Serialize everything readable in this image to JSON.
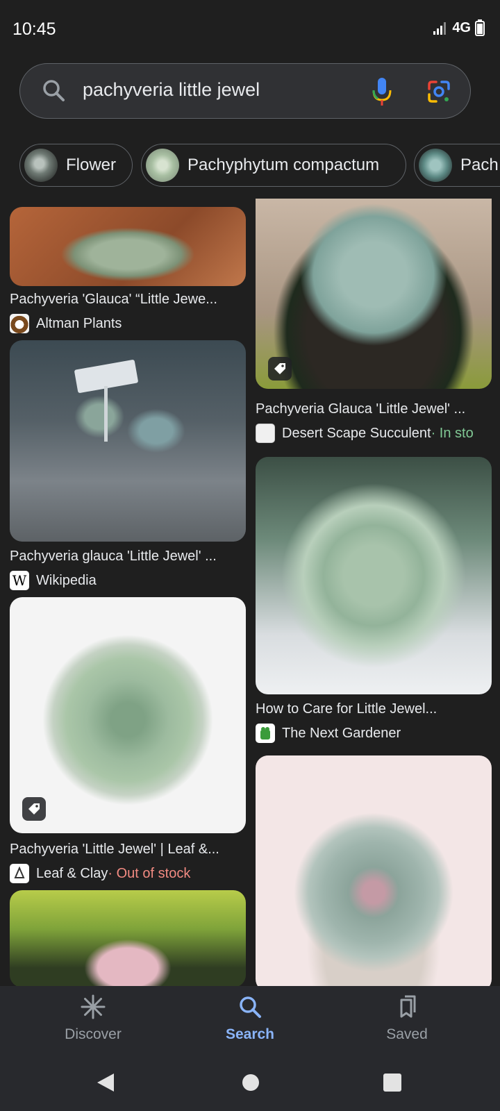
{
  "status": {
    "time": "10:45",
    "network": "4G"
  },
  "search": {
    "query": "pachyveria little jewel"
  },
  "chips": [
    {
      "label": "Flower"
    },
    {
      "label": "Pachyphytum compactum"
    },
    {
      "label": "Pach"
    }
  ],
  "results_left": [
    {
      "title": "Pachyveria 'Glauca' “Little Jewe...",
      "source": "Altman Plants",
      "stock": ""
    },
    {
      "title": "Pachyveria glauca 'Little Jewel' ...",
      "source": "Wikipedia",
      "stock": ""
    },
    {
      "title": "Pachyveria 'Little Jewel' | Leaf &...",
      "source": "Leaf & Clay",
      "stock": " · Out of stock"
    }
  ],
  "results_right": [
    {
      "title": "Pachyveria Glauca 'Little Jewel' ...",
      "source": "Desert Scape Succulent",
      "stock": " · In sto"
    },
    {
      "title": "How to Care for Little Jewel...",
      "source": "The Next Gardener",
      "stock": ""
    }
  ],
  "bottom_nav": {
    "discover": "Discover",
    "search": "Search",
    "saved": "Saved"
  },
  "colors": {
    "background": "#1f1f1f",
    "active": "#8ab4f8",
    "in_stock": "#81c995",
    "out_of_stock": "#f28b82"
  }
}
